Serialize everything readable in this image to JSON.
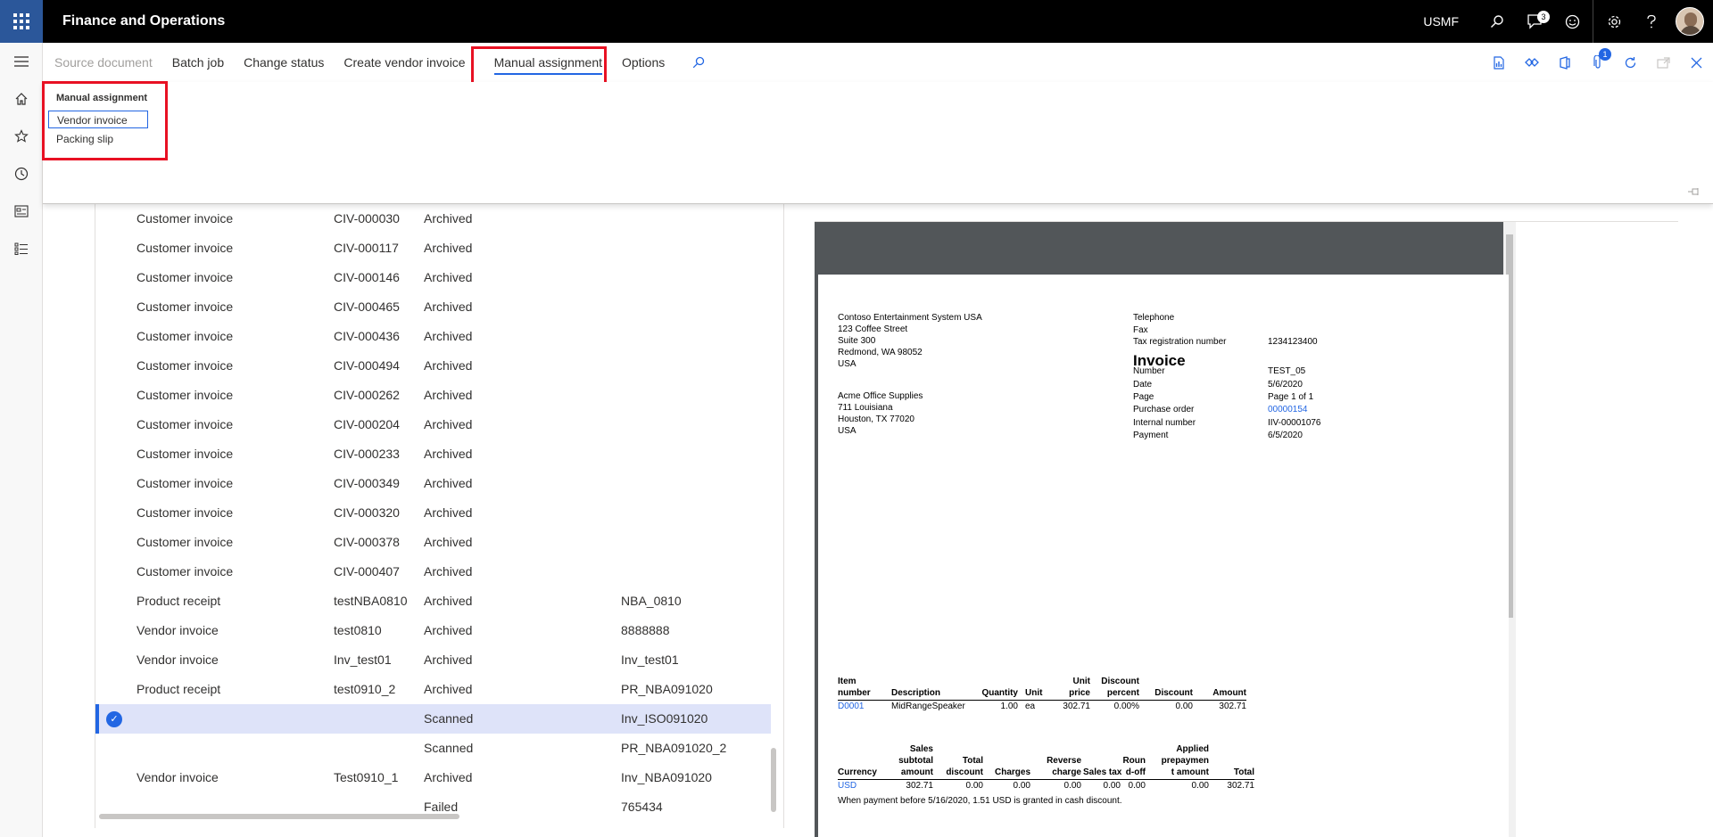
{
  "app": {
    "title": "Finance and Operations",
    "company": "USMF",
    "notification_count": "3"
  },
  "icons": {
    "waffle": "waffle-icon",
    "search": "search-icon",
    "notifications": "notification-icon",
    "feedback": "smiley-icon",
    "settings": "gear-icon",
    "help": "help-icon"
  },
  "action_bar": {
    "items": [
      "Source document",
      "Batch job",
      "Change status",
      "Create vendor invoice",
      "Manual assignment",
      "Options"
    ],
    "attach_count": "1"
  },
  "manual_assignment_menu": {
    "group_title": "Manual assignment",
    "items": [
      "Vendor invoice",
      "Packing slip"
    ]
  },
  "grid": {
    "rows": [
      [
        "Customer invoice",
        "CIV-000030",
        "Archived",
        ""
      ],
      [
        "Customer invoice",
        "CIV-000117",
        "Archived",
        ""
      ],
      [
        "Customer invoice",
        "CIV-000146",
        "Archived",
        ""
      ],
      [
        "Customer invoice",
        "CIV-000465",
        "Archived",
        ""
      ],
      [
        "Customer invoice",
        "CIV-000436",
        "Archived",
        ""
      ],
      [
        "Customer invoice",
        "CIV-000494",
        "Archived",
        ""
      ],
      [
        "Customer invoice",
        "CIV-000262",
        "Archived",
        ""
      ],
      [
        "Customer invoice",
        "CIV-000204",
        "Archived",
        ""
      ],
      [
        "Customer invoice",
        "CIV-000233",
        "Archived",
        ""
      ],
      [
        "Customer invoice",
        "CIV-000349",
        "Archived",
        ""
      ],
      [
        "Customer invoice",
        "CIV-000320",
        "Archived",
        ""
      ],
      [
        "Customer invoice",
        "CIV-000378",
        "Archived",
        ""
      ],
      [
        "Customer invoice",
        "CIV-000407",
        "Archived",
        ""
      ],
      [
        "Product receipt",
        "testNBA0810",
        "Archived",
        "NBA_0810"
      ],
      [
        "Vendor invoice",
        "test0810",
        "Archived",
        "8888888"
      ],
      [
        "Vendor invoice",
        "Inv_test01",
        "Archived",
        "Inv_test01"
      ],
      [
        "Product receipt",
        "test0910_2",
        "Archived",
        "PR_NBA091020"
      ],
      [
        "",
        "",
        "Scanned",
        "Inv_ISO091020"
      ],
      [
        "",
        "",
        "Scanned",
        "PR_NBA091020_2"
      ],
      [
        "Vendor invoice",
        "Test0910_1",
        "Archived",
        "Inv_NBA091020"
      ],
      [
        "",
        "",
        "Failed",
        "765434"
      ]
    ],
    "selected_row_index": 17
  },
  "invoice": {
    "sender": [
      "Contoso Entertainment System USA",
      "123 Coffee Street",
      "Suite 300",
      "Redmond, WA 98052",
      "USA"
    ],
    "recipient": [
      "Acme Office Supplies",
      "711 Louisiana",
      "Houston, TX 77020",
      "USA"
    ],
    "contact_labels": [
      "Telephone",
      "Fax",
      "Tax registration number"
    ],
    "tax_registration_number": "1234123400",
    "title": "Invoice",
    "fields": [
      {
        "label": "Number",
        "value": "TEST_05"
      },
      {
        "label": "Date",
        "value": "5/6/2020"
      },
      {
        "label": "Page",
        "value": "Page 1 of 1"
      },
      {
        "label": "Purchase order",
        "value": "00000154"
      },
      {
        "label": "Internal number",
        "value": "IIV-00001076"
      },
      {
        "label": "Payment",
        "value": "6/5/2020"
      }
    ],
    "lines_headers": {
      "item": [
        "Item",
        "number"
      ],
      "description": "Description",
      "quantity": "Quantity",
      "unit": "Unit",
      "unit_price": [
        "Unit",
        "price"
      ],
      "discount_percent": [
        "Discount",
        "percent"
      ],
      "discount": "Discount",
      "amount": "Amount"
    },
    "line": {
      "item": "D0001",
      "description": "MidRangeSpeaker",
      "quantity": "1.00",
      "unit": "ea",
      "unit_price": "302.71",
      "discount_percent": "0.00%",
      "discount": "0.00",
      "amount": "302.71"
    },
    "totals_headers": {
      "currency": "Currency",
      "sales_subtotal": [
        "Sales",
        "subtotal",
        "amount"
      ],
      "total_discount": [
        "Total",
        "discount"
      ],
      "charges": "Charges",
      "reverse_charge": [
        "Reverse",
        "charge"
      ],
      "sales_tax": "Sales tax",
      "round_off": [
        "Roun",
        "d-off"
      ],
      "applied_prepayment": [
        "Applied",
        "prepaymen",
        "t amount"
      ],
      "total": "Total"
    },
    "totals": {
      "currency": "USD",
      "sales_subtotal": "302.71",
      "total_discount": "0.00",
      "charges": "0.00",
      "reverse_charge": "0.00",
      "sales_tax": "0.00",
      "round_off": "0.00",
      "applied_prepayment": "0.00",
      "total": "302.71"
    },
    "cash_discount_note": "When payment before 5/16/2020, 1.51 USD is granted in cash discount."
  }
}
